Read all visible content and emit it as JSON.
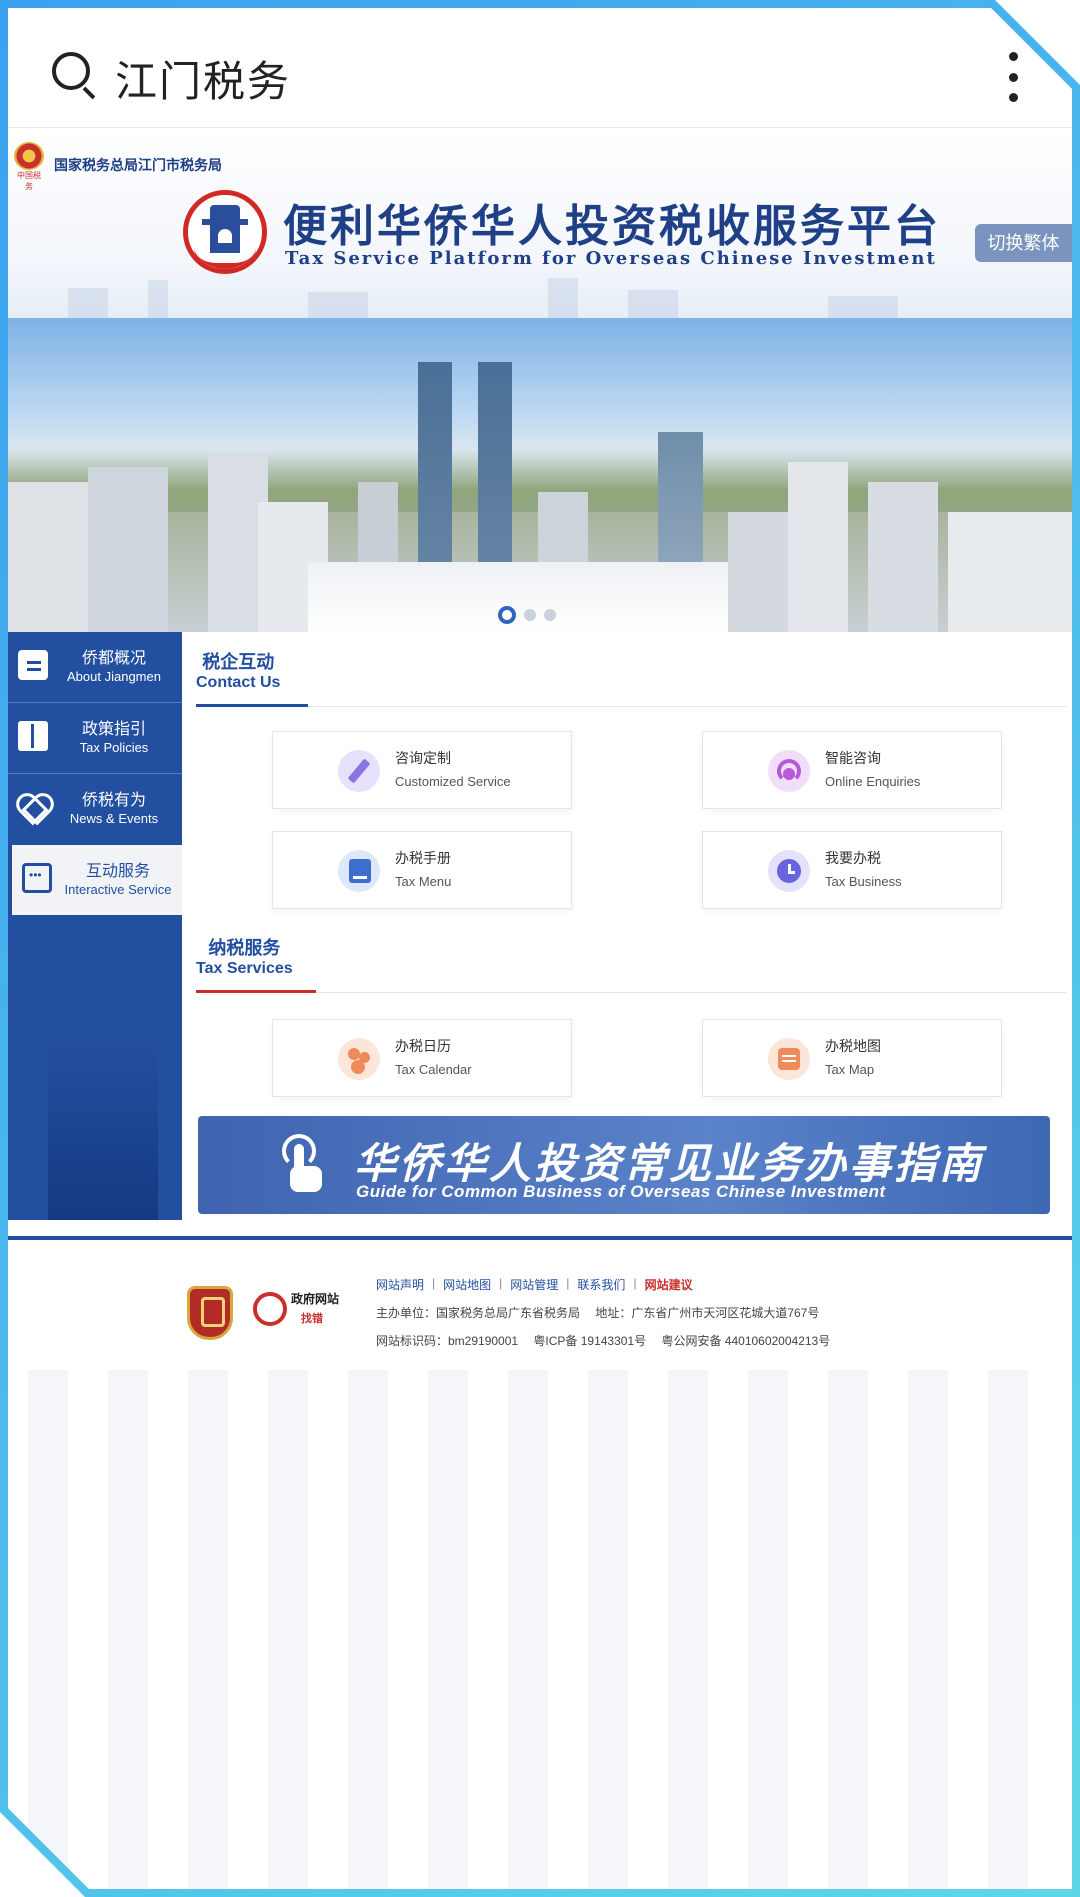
{
  "topbar": {
    "title": "江门税务"
  },
  "header": {
    "bureau_name": "国家税务总局江门市税务局",
    "platform_cn": "便利华侨华人投资税收服务平台",
    "platform_en": "Tax Service Platform for Overseas Chinese Investment",
    "switch_label": "切换繁体"
  },
  "banner": {
    "slide_count": 3,
    "active_slide": 1
  },
  "sidebar": {
    "items": [
      {
        "cn": "侨都概况",
        "en": "About Jiangmen",
        "icon": "chat-icon"
      },
      {
        "cn": "政策指引",
        "en": "Tax Policies",
        "icon": "book-icon"
      },
      {
        "cn": "侨税有为",
        "en": "News & Events",
        "icon": "heart-icon"
      },
      {
        "cn": "互动服务",
        "en": "Interactive Service",
        "icon": "message-icon",
        "active": true
      }
    ]
  },
  "sections": {
    "contact": {
      "cn": "税企互动",
      "en": "Contact Us",
      "cards": [
        {
          "cn": "咨询定制",
          "en": "Customized Service",
          "icon": "pen-icon"
        },
        {
          "cn": "智能咨询",
          "en": "Online Enquiries",
          "icon": "headset-icon"
        },
        {
          "cn": "办税手册",
          "en": "Tax Menu",
          "icon": "manual-icon"
        },
        {
          "cn": "我要办税",
          "en": "Tax Business",
          "icon": "clock-icon"
        }
      ]
    },
    "services": {
      "cn": "纳税服务",
      "en": "Tax Services",
      "cards": [
        {
          "cn": "办税日历",
          "en": "Tax Calendar",
          "icon": "calendar-dots-icon"
        },
        {
          "cn": "办税地图",
          "en": "Tax Map",
          "icon": "map-list-icon"
        }
      ]
    }
  },
  "guide": {
    "cn": "华侨华人投资常见业务办事指南",
    "en": "Guide for Common Business of Overseas Chinese Investment"
  },
  "footer": {
    "links": [
      "网站声明",
      "网站地图",
      "网站管理",
      "联系我们"
    ],
    "suggest": "网站建议",
    "badge2_title": "政府网站",
    "badge2_sub": "找错",
    "sponsor": "主办单位：国家税务总局广东省税务局　 地址：广东省广州市天河区花城大道767号",
    "ids": "网站标识码：bm29190001　 粤ICP备 19143301号　 粤公网安备 44010602004213号"
  }
}
